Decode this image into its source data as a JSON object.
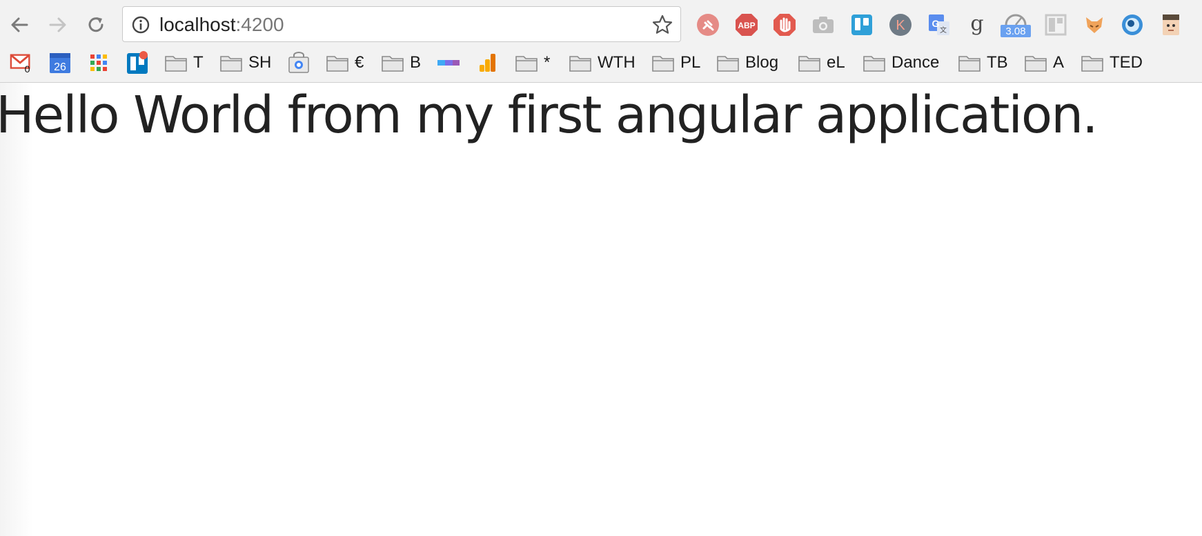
{
  "toolbar": {
    "back_icon": "back-arrow-icon",
    "forward_icon": "forward-arrow-icon",
    "reload_icon": "reload-icon"
  },
  "omnibox": {
    "host": "localhost",
    "port": ":4200",
    "info_icon": "info-icon",
    "bookmark_icon": "star-icon"
  },
  "extensions": {
    "badge_value": "3.08",
    "avatar_letter": "K",
    "g_letter": "g",
    "abp_label": "ABP"
  },
  "bookmarks": {
    "gmail_count": "0",
    "calendar_day": "26",
    "items": [
      {
        "label": "T"
      },
      {
        "label": "SH"
      },
      {
        "label": "€"
      },
      {
        "label": "B"
      },
      {
        "label": "*"
      },
      {
        "label": "WTH"
      },
      {
        "label": "PL"
      },
      {
        "label": "Blog"
      },
      {
        "label": "eL"
      },
      {
        "label": "Dance"
      },
      {
        "label": "TB"
      },
      {
        "label": "A"
      },
      {
        "label": "TED"
      }
    ]
  },
  "page": {
    "heading": "Hello World from my first angular application."
  },
  "colors": {
    "chrome_bg": "#f2f2f2",
    "text": "#222222",
    "port_grey": "#777777",
    "stop_red": "#e25a4f",
    "trello_blue": "#0079bf"
  }
}
